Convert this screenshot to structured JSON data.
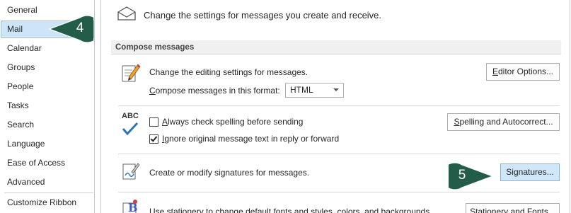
{
  "sidebar": {
    "items": [
      {
        "label": "General"
      },
      {
        "label": "Mail"
      },
      {
        "label": "Calendar"
      },
      {
        "label": "Groups"
      },
      {
        "label": "People"
      },
      {
        "label": "Tasks"
      },
      {
        "label": "Search"
      },
      {
        "label": "Language"
      },
      {
        "label": "Ease of Access"
      },
      {
        "label": "Advanced"
      },
      {
        "label": "Customize Ribbon"
      }
    ],
    "selected": "Mail"
  },
  "header": {
    "text": "Change the settings for messages you create and receive."
  },
  "compose": {
    "section_title": "Compose messages",
    "editing_text": "Change the editing settings for messages.",
    "editor_options_button": {
      "prefix": "",
      "underline": "E",
      "suffix": "ditor Options..."
    },
    "format_label": {
      "prefix": "",
      "underline": "C",
      "suffix": "ompose messages in this format:"
    },
    "format_value": "HTML",
    "abc_label": "ABC",
    "spell_check_label": {
      "prefix": "",
      "underline": "A",
      "suffix": "lways check spelling before sending"
    },
    "spell_check_checked": false,
    "ignore_original_label": {
      "prefix": "",
      "underline": "I",
      "suffix": "gnore original message text in reply or forward"
    },
    "ignore_original_checked": true,
    "spelling_button": {
      "prefix": "",
      "underline": "S",
      "suffix": "pelling and Autocorrect..."
    },
    "signatures_text": "Create or modify signatures for messages.",
    "signatures_button": {
      "prefix": "Si",
      "underline": "g",
      "suffix": "natures..."
    },
    "stationery_text": "Use stationery to change default fonts and styles, colors, and backgrounds.",
    "stationery_button": "Stationery and Fonts..."
  },
  "callouts": {
    "step4": "4",
    "step5": "5"
  },
  "colors": {
    "callout_fill": "#245c4a",
    "selected_bg": "#cde6f7",
    "button_highlight": "#cfe7f9"
  }
}
